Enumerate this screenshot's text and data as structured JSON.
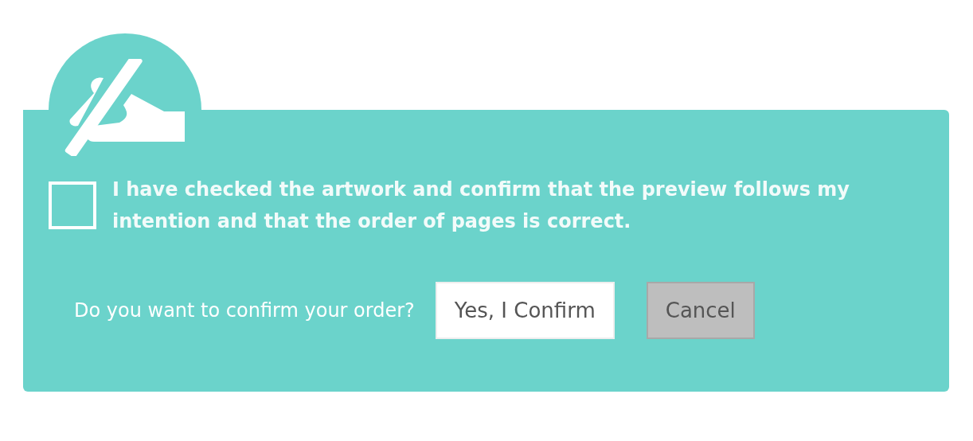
{
  "agreement": {
    "text": "I have checked the artwork and confirm that the preview follows my intention and that the order of pages is correct.",
    "checked": false
  },
  "prompt": "Do you want to confirm your order?",
  "buttons": [
    {
      "label": "Yes, I Confirm",
      "kind": "primary"
    },
    {
      "label": "Cancel",
      "kind": "secondary"
    }
  ]
}
